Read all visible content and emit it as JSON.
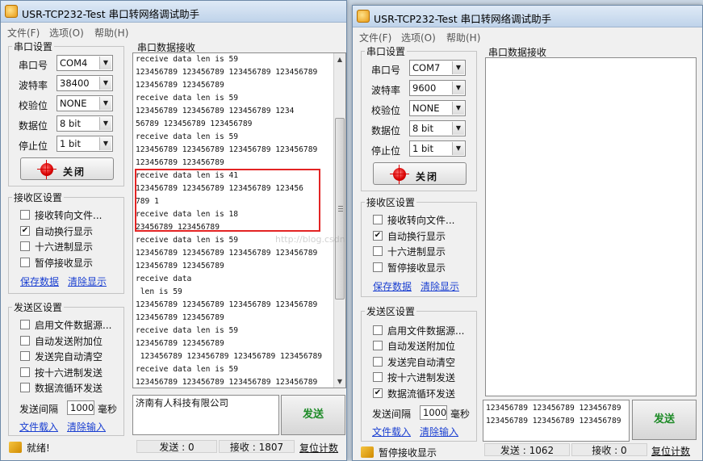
{
  "left_window": {
    "title": "USR-TCP232-Test 串口转网络调试助手",
    "menu": [
      "文件(F)",
      "选项(O)",
      "帮助(H)"
    ],
    "serial_settings": {
      "title": "串口设置",
      "port_label": "串口号",
      "port_value": "COM4",
      "baud_label": "波特率",
      "baud_value": "38400",
      "parity_label": "校验位",
      "parity_value": "NONE",
      "data_bits_label": "数据位",
      "data_bits_value": "8 bit",
      "stop_bits_label": "停止位",
      "stop_bits_value": "1 bit",
      "close_button": "关闭"
    },
    "receive_settings": {
      "title": "接收区设置",
      "options": [
        {
          "label": "接收转向文件...",
          "checked": false
        },
        {
          "label": "自动换行显示",
          "checked": true
        },
        {
          "label": "十六进制显示",
          "checked": false
        },
        {
          "label": "暂停接收显示",
          "checked": false
        }
      ],
      "save_link": "保存数据",
      "clear_link": "清除显示"
    },
    "send_settings": {
      "title": "发送区设置",
      "options": [
        {
          "label": "启用文件数据源...",
          "checked": false
        },
        {
          "label": "自动发送附加位",
          "checked": false
        },
        {
          "label": "发送完自动清空",
          "checked": false
        },
        {
          "label": "按十六进制发送",
          "checked": false
        },
        {
          "label": "数据流循环发送",
          "checked": false
        }
      ],
      "interval_label": "发送间隔",
      "interval_value": "1000",
      "interval_unit": "毫秒",
      "file_load_link": "文件载入",
      "clear_input_link": "清除输入"
    },
    "receive_area": {
      "title": "串口数据接收",
      "lines": [
        "receive data len is 59",
        "123456789 123456789 123456789 123456789",
        "123456789 123456789",
        "receive data len is 59",
        "123456789 123456789 123456789 1234",
        "56789 123456789 123456789",
        "receive data len is 59",
        "123456789 123456789 123456789 123456789",
        "123456789 123456789",
        "receive data len is 41",
        "123456789 123456789 123456789 123456",
        "789 1",
        "receive data len is 18",
        "23456789 123456789",
        "receive data len is 59",
        "123456789 123456789 123456789 123456789",
        "123456789 123456789",
        "receive data",
        " len is 59",
        "123456789 123456789 123456789 123456789",
        "123456789 123456789",
        "receive data len is 59",
        "123456789 123456789",
        " 123456789 123456789 123456789 123456789",
        "receive data len is 59",
        "123456789 123456789 123456789 123456789"
      ]
    },
    "send_area": {
      "text": "济南有人科技有限公司",
      "send_button": "发送"
    },
    "status": {
      "ready": "就绪!",
      "sent": "发送 : 0",
      "received": "接收 : 1807",
      "reset": "复位计数"
    }
  },
  "right_window": {
    "title": "USR-TCP232-Test 串口转网络调试助手",
    "menu": [
      "文件(F)",
      "选项(O)",
      "帮助(H)"
    ],
    "serial_settings": {
      "title": "串口设置",
      "port_label": "串口号",
      "port_value": "COM7",
      "baud_label": "波特率",
      "baud_value": "9600",
      "parity_label": "校验位",
      "parity_value": "NONE",
      "data_bits_label": "数据位",
      "data_bits_value": "8 bit",
      "stop_bits_label": "停止位",
      "stop_bits_value": "1 bit",
      "close_button": "关闭"
    },
    "receive_settings": {
      "title": "接收区设置",
      "options": [
        {
          "label": "接收转向文件...",
          "checked": false
        },
        {
          "label": "自动换行显示",
          "checked": true
        },
        {
          "label": "十六进制显示",
          "checked": false
        },
        {
          "label": "暂停接收显示",
          "checked": false
        }
      ],
      "save_link": "保存数据",
      "clear_link": "清除显示"
    },
    "send_settings": {
      "title": "发送区设置",
      "options": [
        {
          "label": "启用文件数据源...",
          "checked": false
        },
        {
          "label": "自动发送附加位",
          "checked": false
        },
        {
          "label": "发送完自动清空",
          "checked": false
        },
        {
          "label": "按十六进制发送",
          "checked": false
        },
        {
          "label": "数据流循环发送",
          "checked": true
        }
      ],
      "interval_label": "发送间隔",
      "interval_value": "1000",
      "interval_unit": "毫秒",
      "file_load_link": "文件载入",
      "clear_input_link": "清除输入"
    },
    "receive_area": {
      "title": "串口数据接收",
      "lines": []
    },
    "send_area": {
      "lines": [
        "123456789 123456789 123456789",
        "123456789 123456789 123456789"
      ],
      "send_button": "发送"
    },
    "status": {
      "ready": "暂停接收显示",
      "sent": "发送 : 1062",
      "received": "接收 : 0",
      "reset": "复位计数"
    }
  },
  "watermark": "http://blog.csdn.net/",
  "colors": {
    "highlight_box": "#e32424",
    "send_button_text": "#1c8a26",
    "link": "#1a3fd1"
  }
}
